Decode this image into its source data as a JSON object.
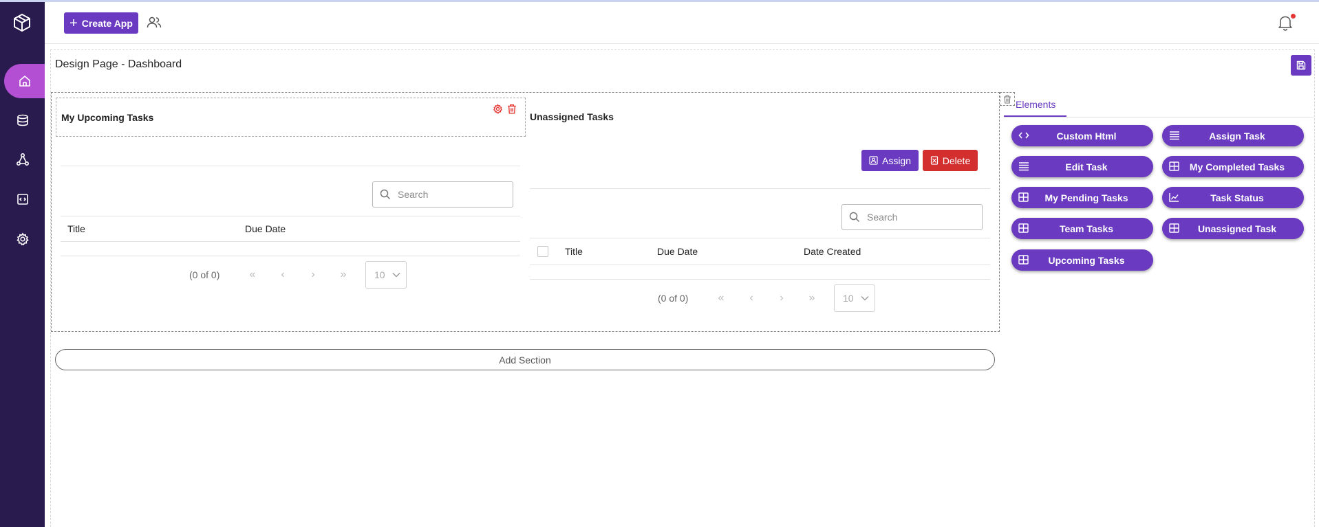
{
  "topbar": {
    "create_app_label": "Create App"
  },
  "page": {
    "title": "Design Page - Dashboard"
  },
  "widgets": {
    "upcoming": {
      "title": "My Upcoming Tasks",
      "search_placeholder": "Search",
      "columns": [
        "Title",
        "Due Date"
      ],
      "pagination": {
        "count": "(0 of 0)",
        "page_size": "10"
      }
    },
    "unassigned": {
      "title": "Unassigned Tasks",
      "assign_label": "Assign",
      "delete_label": "Delete",
      "search_placeholder": "Search",
      "columns": [
        "Title",
        "Due Date",
        "Date Created"
      ],
      "pagination": {
        "count": "(0 of 0)",
        "page_size": "10"
      }
    }
  },
  "add_section_label": "Add Section",
  "elements_panel": {
    "tab_label": "Elements",
    "items": [
      {
        "label": "Custom Html",
        "icon": "code-icon"
      },
      {
        "label": "Assign Task",
        "icon": "lines-icon"
      },
      {
        "label": "Edit Task",
        "icon": "lines-icon"
      },
      {
        "label": "My Completed Tasks",
        "icon": "table-icon"
      },
      {
        "label": "My Pending Tasks",
        "icon": "table-icon"
      },
      {
        "label": "Task Status",
        "icon": "chart-icon"
      },
      {
        "label": "Team Tasks",
        "icon": "table-icon"
      },
      {
        "label": "Unassigned Task",
        "icon": "table-icon"
      },
      {
        "label": "Upcoming Tasks",
        "icon": "table-icon"
      }
    ]
  },
  "colors": {
    "sidebar": "#2a1b4f",
    "sidebar_active": "#b24fd3",
    "accent": "#6a3ac0",
    "danger": "#d32f2f"
  }
}
